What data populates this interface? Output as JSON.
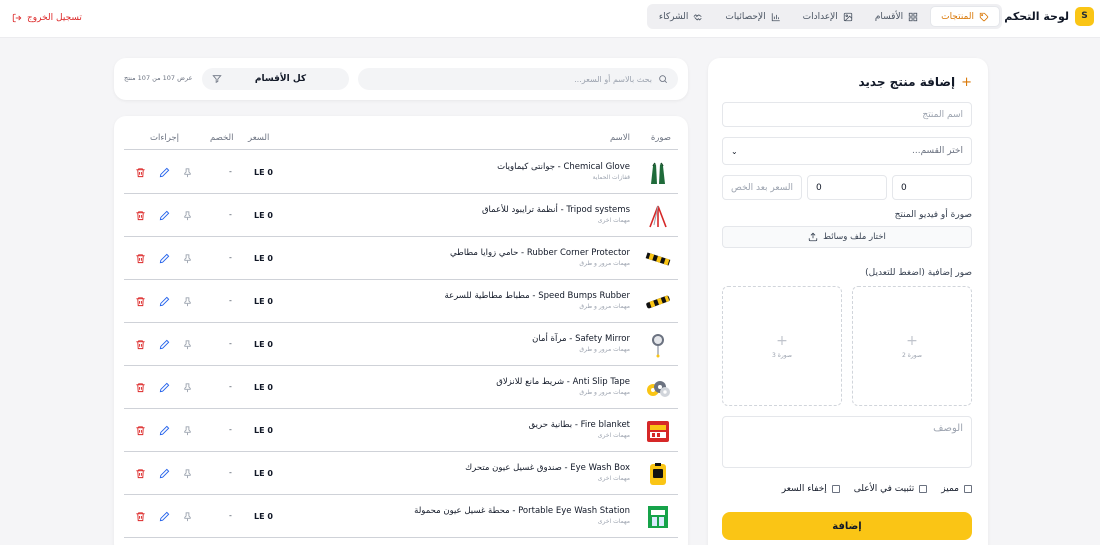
{
  "brand": {
    "badge": "S",
    "title": "لوحة التحكم"
  },
  "nav": {
    "tabs": [
      {
        "label": "المنتجات",
        "icon": "tag-icon",
        "active": true
      },
      {
        "label": "الأقسام",
        "icon": "grid-icon",
        "active": false
      },
      {
        "label": "الإعدادات",
        "icon": "image-icon",
        "active": false
      },
      {
        "label": "الإحصائيات",
        "icon": "bar-chart-icon",
        "active": false
      },
      {
        "label": "الشركاء",
        "icon": "handshake-icon",
        "active": false
      }
    ],
    "logout": "تسجيل الخروج"
  },
  "form": {
    "title": "إضافة منتج جديد",
    "name_placeholder": "اسم المنتج",
    "category_placeholder": "اختر القسم...",
    "price_value": "0",
    "discount_value": "0",
    "final_price_placeholder": "السعر بعد الخص",
    "media_label": "صورة أو فيديو المنتج",
    "upload_label": "اختار ملف وسائط",
    "extra_images_label": "صور إضافية (اضغط للتعديل)",
    "slot_2": "صورة 2",
    "slot_3": "صورة 3",
    "desc_placeholder": "الوصف",
    "featured_label": "مميز",
    "pin_label": "تثبيت في الأعلى",
    "hide_price_label": "إخفاء السعر",
    "submit_label": "إضافة"
  },
  "filter": {
    "search_placeholder": "بحث بالاسم أو السعر...",
    "category_value": "كل الأقسام",
    "count_text": "عرض 107 من 107 منتج"
  },
  "table": {
    "headers": {
      "image": "صورة",
      "name": "الاسم",
      "price": "السعر",
      "discount": "الخصم",
      "actions": "إجراءات"
    },
    "rows": [
      {
        "name": "Chemical Glove - جوانتى كيماويات",
        "category": "قفازات الحماية",
        "price": "LE 0",
        "discount": "-",
        "thumb": "glove"
      },
      {
        "name": "Tripod systems - أنظمة ترايبود للأعماق",
        "category": "مهمات اخرى",
        "price": "LE 0",
        "discount": "-",
        "thumb": "tripod"
      },
      {
        "name": "Rubber Corner Protector - حامي زوايا مطاطي",
        "category": "مهمات مرور و طرق",
        "price": "LE 0",
        "discount": "-",
        "thumb": "corner"
      },
      {
        "name": "Speed Bumps Rubber - مطباط مطاطية للسرعة",
        "category": "مهمات مرور و طرق",
        "price": "LE 0",
        "discount": "-",
        "thumb": "bump"
      },
      {
        "name": "Safety Mirror - مرآة أمان",
        "category": "مهمات مرور و طرق",
        "price": "LE 0",
        "discount": "-",
        "thumb": "mirror"
      },
      {
        "name": "Anti Slip Tape - شريط مانع للانزلاق",
        "category": "مهمات مرور و طرق",
        "price": "LE 0",
        "discount": "-",
        "thumb": "tape"
      },
      {
        "name": "Fire blanket - بطانية حريق",
        "category": "مهمات اخرى",
        "price": "LE 0",
        "discount": "-",
        "thumb": "blanket"
      },
      {
        "name": "Eye Wash Box - صندوق غسيل عيون متحرك",
        "category": "مهمات اخرى",
        "price": "LE 0",
        "discount": "-",
        "thumb": "eyebox"
      },
      {
        "name": "Portable Eye Wash Station - محطة غسيل عيون محمولة",
        "category": "مهمات اخرى",
        "price": "LE 0",
        "discount": "-",
        "thumb": "eyestation"
      }
    ]
  },
  "colors": {
    "accent": "#fac515",
    "active_tab_text": "#d97706",
    "danger": "#dc2626",
    "edit": "#2563eb",
    "pin": "#9ca3af"
  }
}
